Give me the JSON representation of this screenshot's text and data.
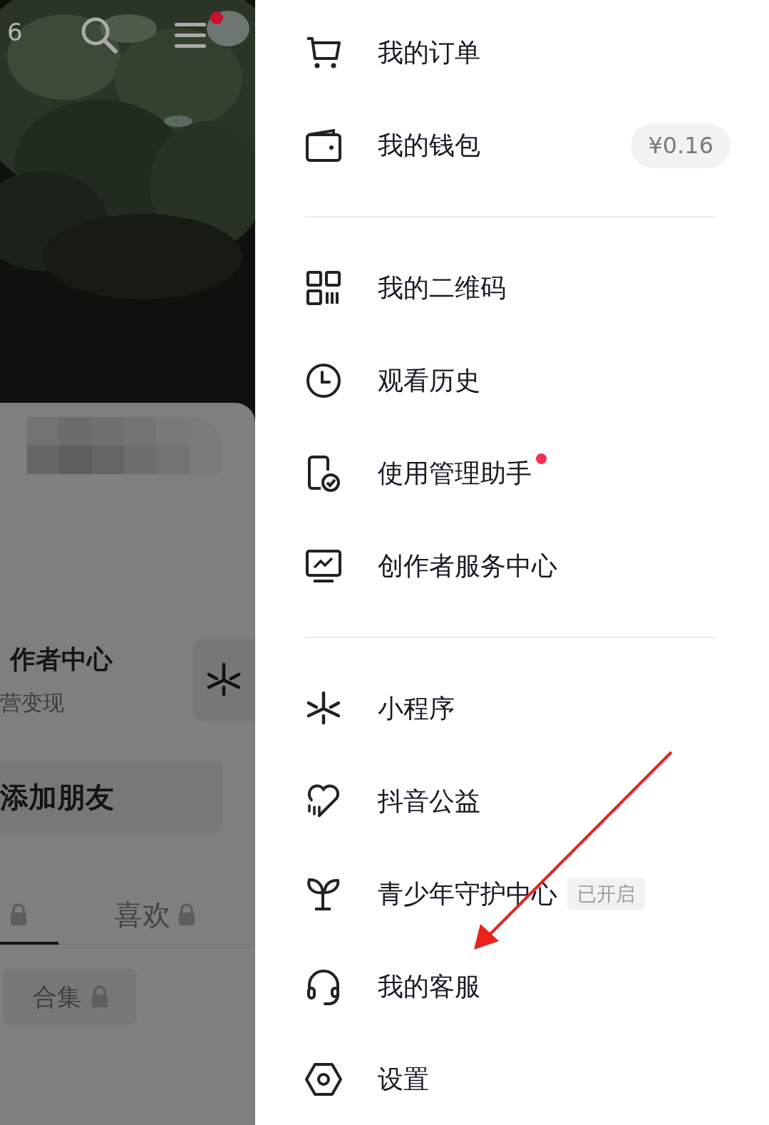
{
  "profile_backdrop": {
    "top_bar": {
      "count": "6",
      "menu_has_dot": true
    },
    "creator_card": {
      "title": "作者中心",
      "subtitle": "营变现"
    },
    "add_friend_button": "添加朋友",
    "tabs": [
      {
        "locked": true,
        "selected": true
      },
      {
        "label": "喜欢",
        "locked": true,
        "selected": false
      }
    ],
    "collection_chip": {
      "label": "合集",
      "locked": true
    }
  },
  "menu": {
    "sections": [
      [
        {
          "kind": "cart",
          "label": "我的订单"
        },
        {
          "kind": "wallet",
          "label": "我的钱包",
          "badge": "¥0.16"
        }
      ],
      [
        {
          "kind": "qrcode",
          "label": "我的二维码"
        },
        {
          "kind": "clock",
          "label": "观看历史"
        },
        {
          "kind": "phone-check",
          "label": "使用管理助手",
          "dot": true
        },
        {
          "kind": "monitor",
          "label": "创作者服务中心"
        }
      ],
      [
        {
          "kind": "sparkle",
          "label": "小程序"
        },
        {
          "kind": "heart",
          "label": "抖音公益"
        },
        {
          "kind": "sprout",
          "label": "青少年守护中心",
          "tag": "已开启"
        },
        {
          "kind": "headset",
          "label": "我的客服"
        },
        {
          "kind": "hexagon",
          "label": "设置"
        }
      ]
    ]
  }
}
